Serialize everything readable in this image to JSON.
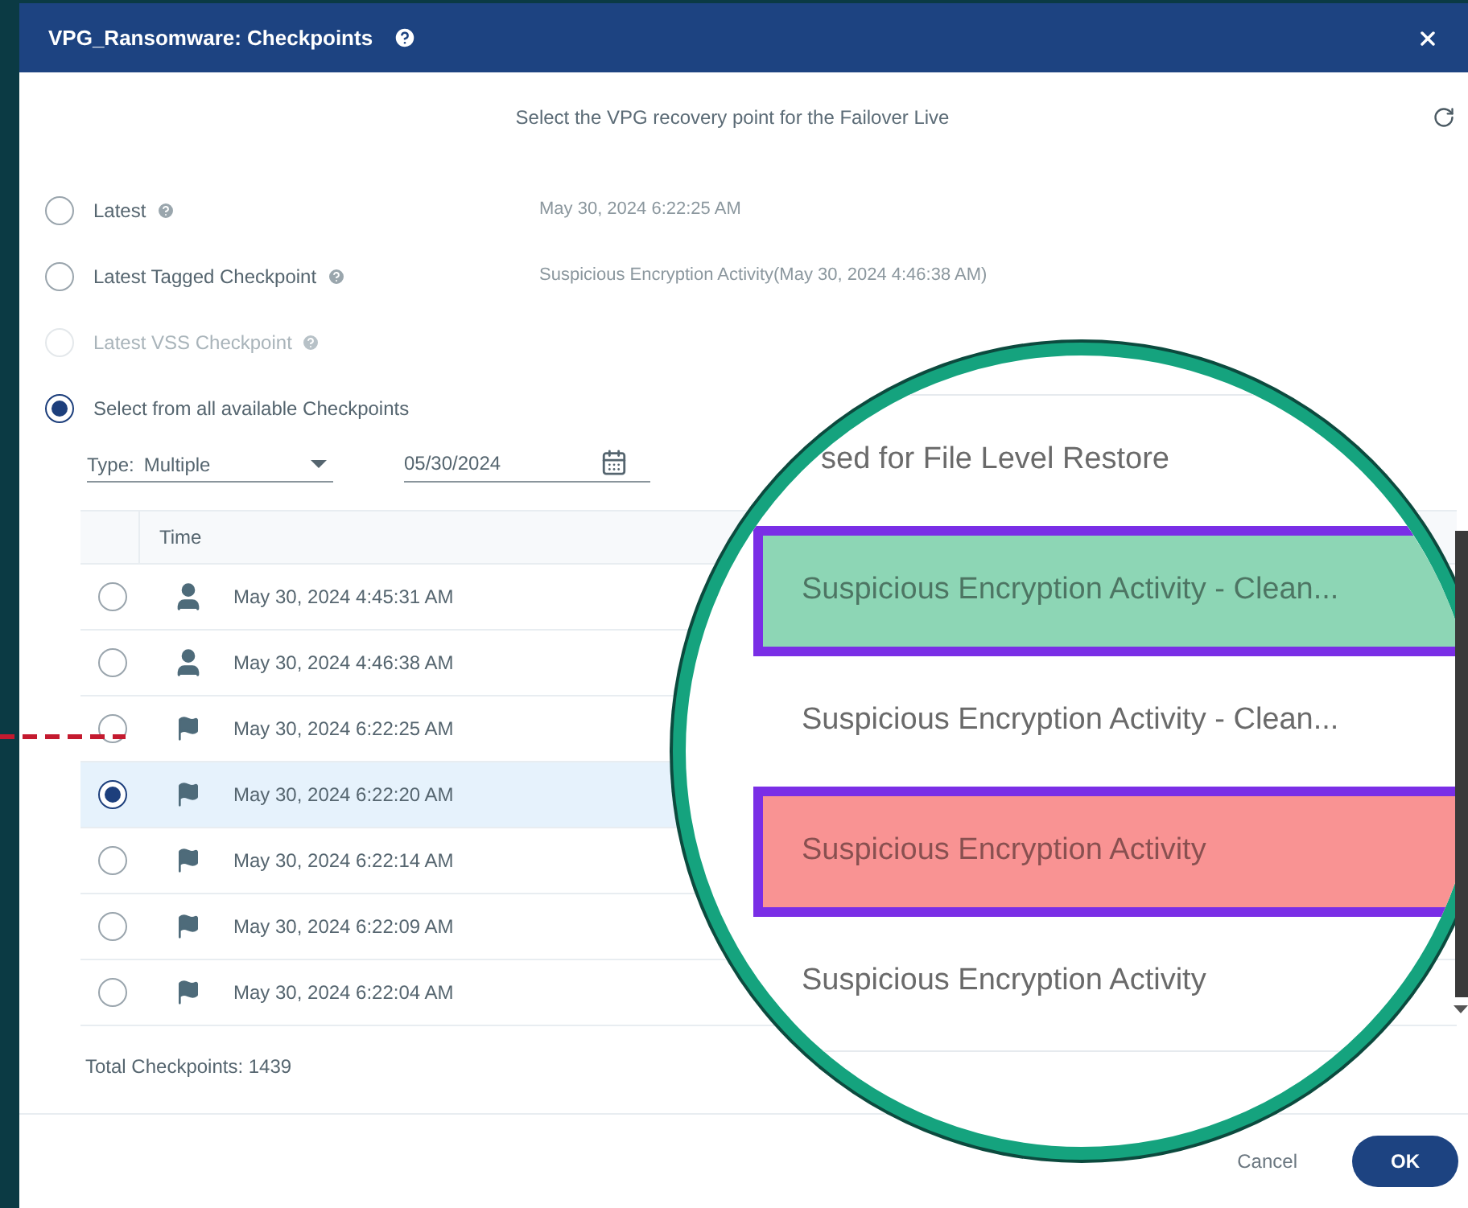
{
  "dialog": {
    "title": "VPG_Ransomware: Checkpoints",
    "subtitle": "Select the VPG recovery point for the Failover Live"
  },
  "options": [
    {
      "label": "Latest",
      "help": true,
      "value": "May 30, 2024 6:22:25 AM",
      "selected": false,
      "disabled": false
    },
    {
      "label": "Latest Tagged Checkpoint",
      "help": true,
      "value": "Suspicious Encryption Activity(May 30, 2024 4:46:38 AM)",
      "selected": false,
      "disabled": false
    },
    {
      "label": "Latest VSS Checkpoint",
      "help": true,
      "selected": false,
      "disabled": true
    },
    {
      "label": "Select from all available Checkpoints",
      "help": false,
      "selected": true,
      "disabled": false
    }
  ],
  "filters": {
    "type_label": "Type:",
    "type_value": "Multiple",
    "date": "05/30/2024"
  },
  "table": {
    "columns": [
      "Time"
    ],
    "rows": [
      {
        "kind": "user",
        "time": "May 30, 2024 4:45:31 AM",
        "selected": false
      },
      {
        "kind": "user",
        "time": "May 30, 2024 4:46:38 AM",
        "selected": false
      },
      {
        "kind": "flag",
        "time": "May 30, 2024 6:22:25 AM",
        "selected": false
      },
      {
        "kind": "flag",
        "time": "May 30, 2024 6:22:20 AM",
        "selected": true
      },
      {
        "kind": "flag",
        "time": "May 30, 2024 6:22:14 AM",
        "selected": false
      },
      {
        "kind": "flag",
        "time": "May 30, 2024 6:22:09 AM",
        "selected": false
      },
      {
        "kind": "flag",
        "time": "May 30, 2024 6:22:04 AM",
        "selected": false
      }
    ]
  },
  "total": "Total Checkpoints: 1439",
  "magnifier": {
    "rows": [
      {
        "text": "sed for File Level Restore",
        "outlined": false
      },
      {
        "text": "Suspicious Encryption Activity - Clean...",
        "color": "#8dd6b5",
        "outlined": true
      },
      {
        "text": "Suspicious Encryption Activity - Clean...",
        "outlined": false
      },
      {
        "text": "Suspicious Encryption Activity",
        "color": "#f99393",
        "outlined": true
      },
      {
        "text": "Suspicious Encryption Activity",
        "outlined": false
      }
    ]
  },
  "buttons": [
    {
      "label": "Cancel",
      "kind": "text"
    },
    {
      "label": "OK",
      "kind": "primary"
    }
  ]
}
